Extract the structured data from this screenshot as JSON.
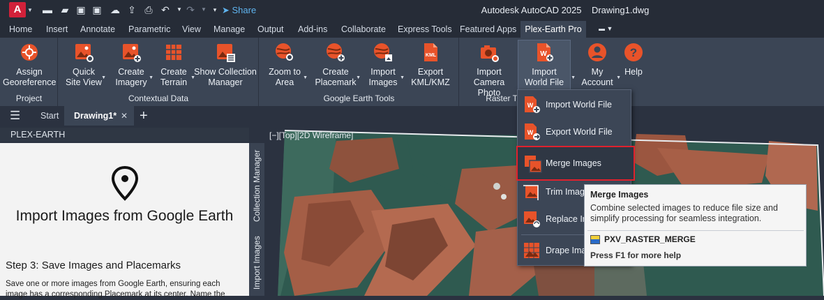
{
  "app": {
    "logo_letter": "A",
    "title": "Autodesk AutoCAD 2025    Drawing1.dwg",
    "share_label": "Share"
  },
  "ribbon_tabs": [
    "Home",
    "Insert",
    "Annotate",
    "Parametric",
    "View",
    "Manage",
    "Output",
    "Add-ins",
    "Collaborate",
    "Express Tools",
    "Featured Apps",
    "Plex-Earth Pro"
  ],
  "active_tab": "Plex-Earth Pro",
  "ribbon": {
    "buttons": {
      "assign": "Assign\nGeoreference",
      "quick_site": "Quick\nSite View",
      "create_imagery": "Create\nImagery",
      "create_terrain": "Create\nTerrain",
      "show_collection": "Show Collection\nManager",
      "zoom_area": "Zoom to\nArea",
      "create_placemark": "Create\nPlacemark",
      "import_images": "Import\nImages",
      "export_kml": "Export\nKML/KMZ",
      "import_camera": "Import\nCamera Photo",
      "import_world": "Import\nWorld File",
      "my_account": "My\nAccount",
      "help": "Help"
    },
    "groups": {
      "project": "Project",
      "contextual": "Contextual Data",
      "google": "Google Earth Tools",
      "raster": "Raster T"
    }
  },
  "doc_tabs": {
    "start": "Start",
    "drawing": "Drawing1*"
  },
  "panel": {
    "header": "PLEX-EARTH",
    "heading": "Import Images from Google Earth",
    "step_title": "Step 3: Save Images and Placemarks",
    "step_text": "Save one or more images from Google Earth, ensuring each image has a corresponding Placemark at its center. Name the"
  },
  "side_tabs": {
    "collection": "Collection Manager",
    "import": "Import Images from..."
  },
  "viewport_label": "[−][Top][2D Wireframe]",
  "dropdown": {
    "items": [
      "Import World File",
      "Export World File",
      "Merge Images",
      "Trim Image",
      "Replace Im",
      "Drape Image"
    ]
  },
  "tooltip": {
    "title": "Merge Images",
    "description": "Combine selected images to reduce file size and simplify processing for seamless integration.",
    "command": "PXV_RASTER_MERGE",
    "help": "Press F1 for more help"
  },
  "colors": {
    "accent_orange": "#e8532a",
    "highlight_red": "#e0212d",
    "share_blue": "#5fb4ef"
  }
}
